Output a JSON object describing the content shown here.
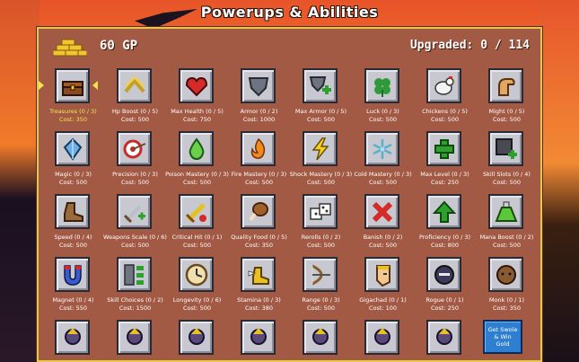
{
  "title": "Powerups & Abilities",
  "gold": {
    "icon": "gold-bars-icon",
    "text": "60 GP"
  },
  "upgraded": "Upgraded: 0 / 114",
  "selected_index": 0,
  "rows": [
    [
      {
        "name": "Treasures (0 / 3)",
        "cost": "Cost: 350",
        "icon": "treasure-chest"
      },
      {
        "name": "Hp Boost (0 / 5)",
        "cost": "Cost: 500",
        "icon": "hp-boost"
      },
      {
        "name": "Max Health (0 / 5)",
        "cost": "Cost: 750",
        "icon": "heart"
      },
      {
        "name": "Armor (0 / 2)",
        "cost": "Cost: 1000",
        "icon": "shield"
      },
      {
        "name": "Max Armor (0 / 5)",
        "cost": "Cost: 500",
        "icon": "shield-plus"
      },
      {
        "name": "Luck (0 / 3)",
        "cost": "Cost: 500",
        "icon": "clover"
      },
      {
        "name": "Chickens (0 / 5)",
        "cost": "Cost: 500",
        "icon": "chicken"
      },
      {
        "name": "Might (0 / 5)",
        "cost": "Cost: 500",
        "icon": "arm"
      }
    ],
    [
      {
        "name": "Magic (0 / 3)",
        "cost": "Cost: 500",
        "icon": "crystal"
      },
      {
        "name": "Precision (0 / 3)",
        "cost": "Cost: 500",
        "icon": "target"
      },
      {
        "name": "Poison Mastery (0 / 3)",
        "cost": "Cost: 500",
        "icon": "poison-drop"
      },
      {
        "name": "Fire Mastery (0 / 3)",
        "cost": "Cost: 500",
        "icon": "fire"
      },
      {
        "name": "Shock Mastery (0 / 3)",
        "cost": "Cost: 500",
        "icon": "lightning"
      },
      {
        "name": "Cold Mastery (0 / 3)",
        "cost": "Cost: 500",
        "icon": "snowflake"
      },
      {
        "name": "Max Level (0 / 3)",
        "cost": "Cost: 250",
        "icon": "green-plus"
      },
      {
        "name": "Skill Slots (0 / 4)",
        "cost": "Cost: 500",
        "icon": "slot-plus"
      }
    ],
    [
      {
        "name": "Speed (0 / 4)",
        "cost": "Cost: 500",
        "icon": "boot"
      },
      {
        "name": "Weapons Scale (0 / 6)",
        "cost": "Cost: 500",
        "icon": "sword-up"
      },
      {
        "name": "Critical Hit (0 / 1)",
        "cost": "Cost: 500",
        "icon": "gold-sword"
      },
      {
        "name": "Quality Food (0 / 5)",
        "cost": "Cost: 350",
        "icon": "drumstick"
      },
      {
        "name": "Rerolls (0 / 2)",
        "cost": "Cost: 500",
        "icon": "dice"
      },
      {
        "name": "Banish (0 / 2)",
        "cost": "Cost: 500",
        "icon": "red-x"
      },
      {
        "name": "Proficiency (0 / 3)",
        "cost": "Cost: 800",
        "icon": "green-arrow"
      },
      {
        "name": "Mana Boost (0 / 2)",
        "cost": "Cost: 500",
        "icon": "potion"
      }
    ],
    [
      {
        "name": "Magnet (0 / 4)",
        "cost": "Cost: 550",
        "icon": "magnet"
      },
      {
        "name": "Skill Choices (0 / 2)",
        "cost": "Cost: 1500",
        "icon": "choices"
      },
      {
        "name": "Longevity (0 / 6)",
        "cost": "Cost: 500",
        "icon": "clock"
      },
      {
        "name": "Stamina (0 / 3)",
        "cost": "Cost: 380",
        "icon": "winged-boot"
      },
      {
        "name": "Range (0 / 3)",
        "cost": "Cost: 500",
        "icon": "bow"
      },
      {
        "name": "Gigachad (0 / 1)",
        "cost": "Cost: 100",
        "icon": "gigachad"
      },
      {
        "name": "Rogue (0 / 1)",
        "cost": "Cost: 250",
        "icon": "rogue"
      },
      {
        "name": "Monk (0 / 1)",
        "cost": "Cost: 350",
        "icon": "monk"
      }
    ],
    [
      {
        "icon": "character-1"
      },
      {
        "icon": "character-2"
      },
      {
        "icon": "character-3"
      },
      {
        "icon": "character-4"
      },
      {
        "icon": "character-5"
      },
      {
        "icon": "character-6"
      },
      {
        "icon": "character-7"
      },
      {
        "button": "Get Swole & Win Gold"
      }
    ]
  ]
}
